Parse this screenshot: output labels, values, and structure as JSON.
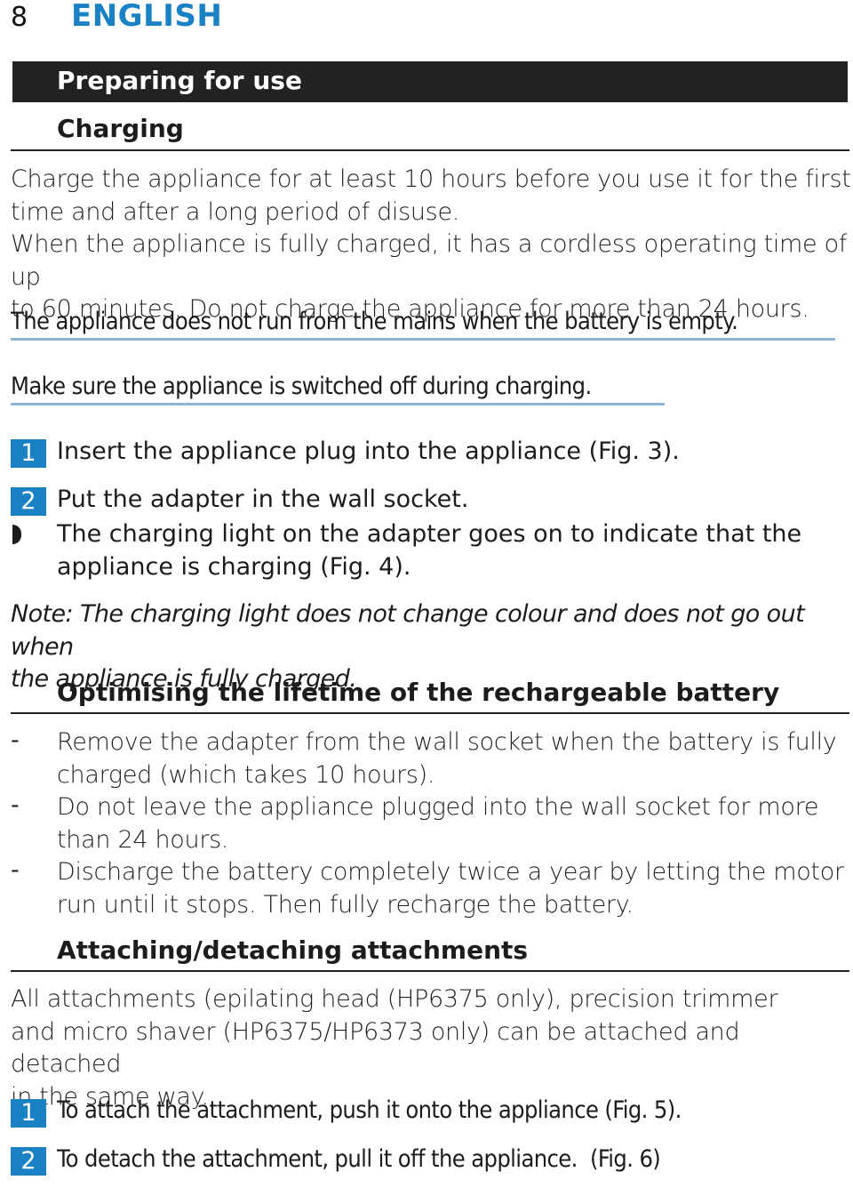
{
  "page": {
    "number": "8",
    "language": "ENGLISH"
  },
  "section": {
    "title": "Preparing for use"
  },
  "charging": {
    "heading": "Charging",
    "para1": [
      "Charge the appliance for at least 10 hours before you use it for the first",
      "time and after a long period of disuse."
    ],
    "para2": [
      "When the appliance is fully charged, it has a cordless operating time of up",
      "to 60 minutes. Do not charge the appliance for more than 24 hours."
    ],
    "warning1": "The appliance does not run from the mains when the battery is empty.",
    "warning2": "Make sure the appliance is switched off during charging.",
    "steps": [
      {
        "num": "1",
        "text": "Insert the appliance plug into the appliance (Fig. 3)."
      },
      {
        "num": "2",
        "text": "Put the adapter in the wall socket."
      }
    ],
    "result": [
      "The charging light on the adapter goes on to indicate that the",
      "appliance is charging (Fig. 4)."
    ],
    "note": [
      "Note: The charging light does not change colour and does not go out when",
      "the appliance is fully charged."
    ]
  },
  "battery": {
    "heading": "Optimising the lifetime of the rechargeable battery",
    "items": [
      {
        "dash": "-",
        "lines": [
          "Remove the adapter from the wall socket when the battery is fully",
          "charged (which takes 10 hours)."
        ]
      },
      {
        "dash": "-",
        "lines": [
          "Do not leave the appliance plugged into the wall socket for more",
          "than 24 hours."
        ]
      },
      {
        "dash": "-",
        "lines": [
          "Discharge the battery completely twice a year by letting the motor",
          "run until it stops. Then fully recharge the battery."
        ]
      }
    ]
  },
  "attachments": {
    "heading": "Attaching/detaching attachments",
    "para": [
      "All attachments (epilating head (HP6375 only), precision trimmer",
      "and micro shaver (HP6375/HP6373 only) can be attached and detached",
      "in the same way."
    ],
    "steps": [
      {
        "num": "1",
        "text": "To attach the attachment, push it onto the appliance (Fig. 5)."
      },
      {
        "num": "2",
        "text": "To detach the attachment, pull it off the appliance.  (Fig. 6)"
      }
    ]
  },
  "colors": {
    "accent": "#1a82c4",
    "bar": "#222222",
    "warning_underline": "#8eb4d4"
  }
}
